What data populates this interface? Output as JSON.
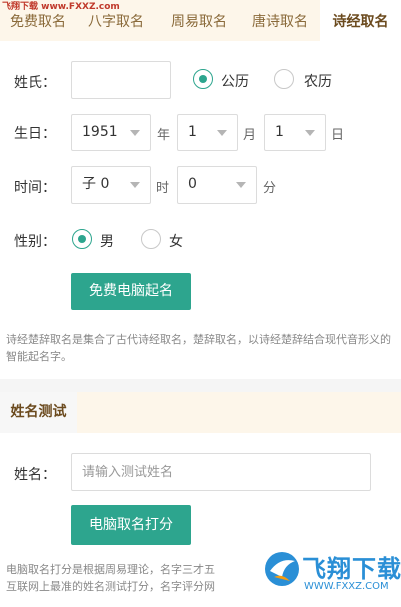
{
  "watermark": "飞翔下载 www.FXXZ.com",
  "tabs": [
    {
      "label": "免费取名",
      "active": false
    },
    {
      "label": "八字取名",
      "active": false
    },
    {
      "label": "周易取名",
      "active": false
    },
    {
      "label": "唐诗取名",
      "active": false
    },
    {
      "label": "诗经取名",
      "active": true
    }
  ],
  "form": {
    "surname_label": "姓氏：",
    "surname_value": "",
    "calendar_options": [
      {
        "label": "公历",
        "checked": true
      },
      {
        "label": "农历",
        "checked": false
      }
    ],
    "birthday_label": "生日：",
    "year_value": "1951",
    "year_unit": "年",
    "month_value": "1",
    "month_unit": "月",
    "day_value": "1",
    "day_unit": "日",
    "time_label": "时间：",
    "hour_value": "子 0",
    "hour_unit": "时",
    "minute_value": "0",
    "minute_unit": "分",
    "gender_label": "性别：",
    "gender_options": [
      {
        "label": "男",
        "checked": true
      },
      {
        "label": "女",
        "checked": false
      }
    ],
    "submit_label": "免费电脑起名",
    "description": "诗经楚辞取名是集合了古代诗经取名，楚辞取名，以诗经楚辞结合现代音形义的智能起名字。"
  },
  "name_test": {
    "section_title": "姓名测试",
    "name_label": "姓名：",
    "name_placeholder": "请输入测试姓名",
    "submit_label": "电脑取名打分",
    "description_line1": "电脑取名打分是根据周易理论，名字三才五",
    "description_line2": "互联网上最准的姓名测试打分，名字评分网"
  },
  "logo": {
    "text": "飞翔下载",
    "url": "WWW.FXXZ.COM"
  },
  "colors": {
    "accent": "#2da58e",
    "tab_bg": "#fdf6ea",
    "tab_text": "#8a6a3a"
  }
}
